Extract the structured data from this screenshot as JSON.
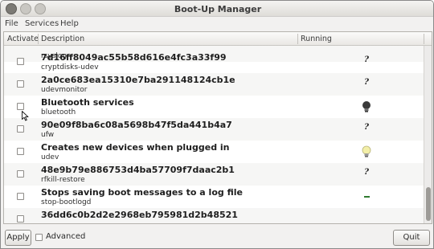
{
  "window": {
    "title": "Boot-Up Manager"
  },
  "menu": {
    "file": "File",
    "services": "Services",
    "help": "Help"
  },
  "columns": {
    "activate": "Activate",
    "description": "Description",
    "running": "Running"
  },
  "partial_row": {
    "name": "rsyslog"
  },
  "rows": [
    {
      "description": "7d16ff8049ac55b58d616e4fc3a33f99",
      "name": "cryptdisks-udev",
      "activated": false,
      "status_icon": "unknown-status-icon",
      "status_text": "?"
    },
    {
      "description": "2a0ce683ea15310e7ba291148124cb1e",
      "name": "udevmonitor",
      "activated": false,
      "status_icon": "unknown-status-icon",
      "status_text": "?"
    },
    {
      "description": "Bluetooth services",
      "name": "bluetooth",
      "activated": false,
      "status_icon": "lightbulb-off-icon",
      "status_text": ""
    },
    {
      "description": "90e09f8ba6c08a5698b47f5da441b4a7",
      "name": "ufw",
      "activated": false,
      "status_icon": "unknown-status-icon",
      "status_text": "?"
    },
    {
      "description": "Creates new devices when plugged in",
      "name": "udev",
      "activated": false,
      "status_icon": "lightbulb-on-icon",
      "status_text": ""
    },
    {
      "description": "48e9b79e886753d4ba57709f7daac2b1",
      "name": "rfkill-restore",
      "activated": false,
      "status_icon": "unknown-status-icon",
      "status_text": "?"
    },
    {
      "description": "Stops saving boot messages to a log file",
      "name": "stop-bootlogd",
      "activated": false,
      "status_icon": "stopped-status-icon",
      "status_text": ""
    },
    {
      "description": "36dd6c0b2d2e2968eb795981d2b48521",
      "name": "",
      "activated": false,
      "status_icon": "",
      "status_text": ""
    }
  ],
  "buttons": {
    "apply": "Apply",
    "advanced": "Advanced",
    "quit": "Quit"
  },
  "colors": {
    "status_stopped": "#2f7a2f",
    "bulb_on": "#f3efa8",
    "bulb_off": "#3a3a3a"
  }
}
